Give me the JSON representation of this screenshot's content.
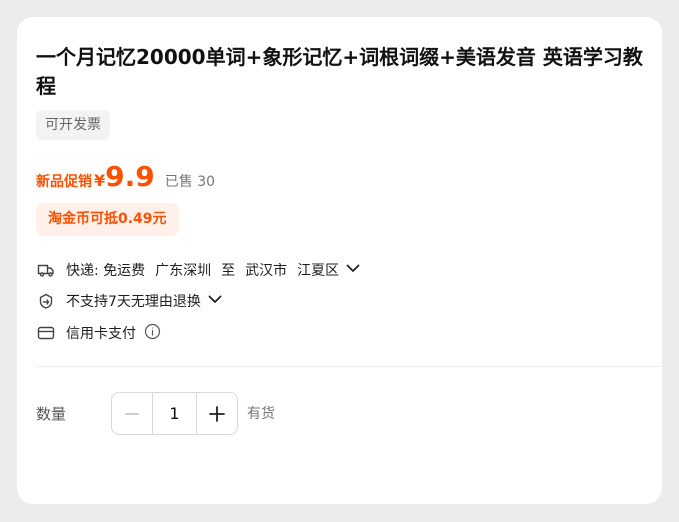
{
  "product": {
    "title": "一个月记忆20000单词+象形记忆+词根词缀+美语发音 英语学习教程",
    "invoice_tag": "可开发票"
  },
  "price": {
    "promo_label": "新品促销",
    "currency": "¥",
    "amount": "9.9",
    "sold_text": "已售 30"
  },
  "coin_offer": "淘金币可抵0.49元",
  "services": {
    "shipping": {
      "icon": "truck-icon",
      "label": "快递: 免运费",
      "from": "广东深圳",
      "to_word": "至",
      "dest_city": "武汉市",
      "dest_district": "江夏区"
    },
    "returns": {
      "icon": "return-policy-icon",
      "label": "不支持7天无理由退换"
    },
    "payment": {
      "icon": "credit-card-icon",
      "label": "信用卡支付"
    }
  },
  "quantity": {
    "label": "数量",
    "value": "1",
    "stock": "有货"
  },
  "colors": {
    "accent": "#ff5000",
    "coin_bg": "#fff0ea",
    "tag_bg": "#f3f3f3"
  }
}
